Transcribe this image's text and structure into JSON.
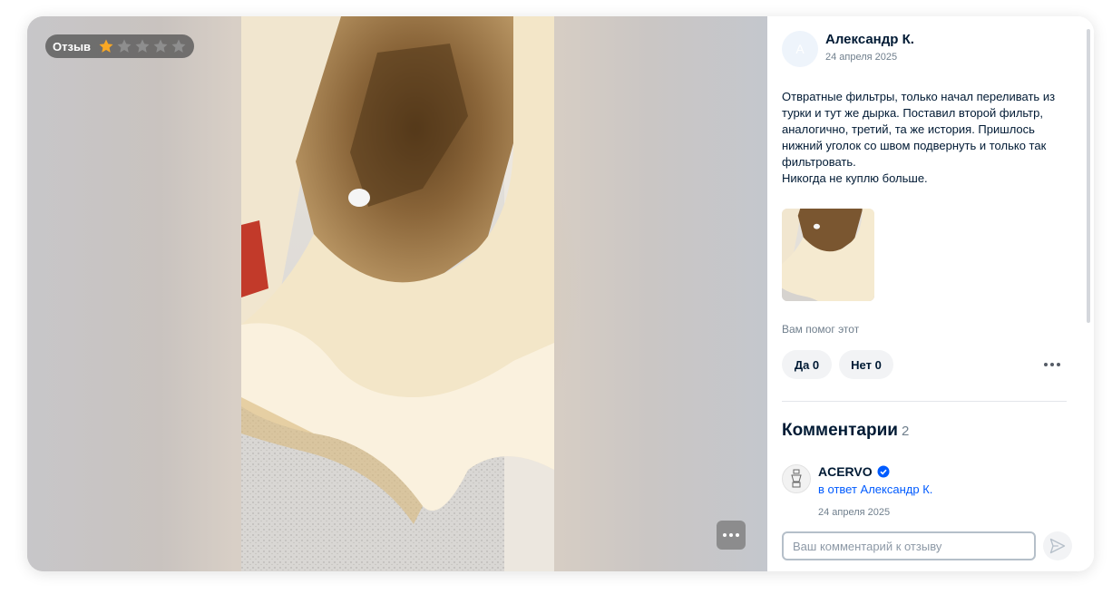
{
  "media": {
    "rating_label": "Отзыв",
    "rating": 1,
    "rating_max": 5,
    "star_color": "#f9a825",
    "star_empty_color": "#9a9a9a"
  },
  "review": {
    "avatar_letter": "А",
    "author": "Александр К.",
    "date": "24 апреля 2025",
    "text": "Отвратные фильтры, только начал переливать из турки и тут же дырка. Поставил второй фильтр, аналогично, третий, та же история. Пришлось нижний уголок со швом подвернуть и только так фильтровать.\nНикогда не куплю больше.",
    "helpful_label": "Вам помог этот",
    "vote_yes": "Да 0",
    "vote_no": "Нет 0"
  },
  "comments": {
    "title": "Комментарии",
    "count": "2",
    "items": [
      {
        "name": "ACERVO",
        "reply_to": "в ответ Александр К.",
        "date": "24 апреля 2025",
        "verified_color": "#005bff"
      }
    ],
    "input_placeholder": "Ваш комментарий к отзыву"
  }
}
